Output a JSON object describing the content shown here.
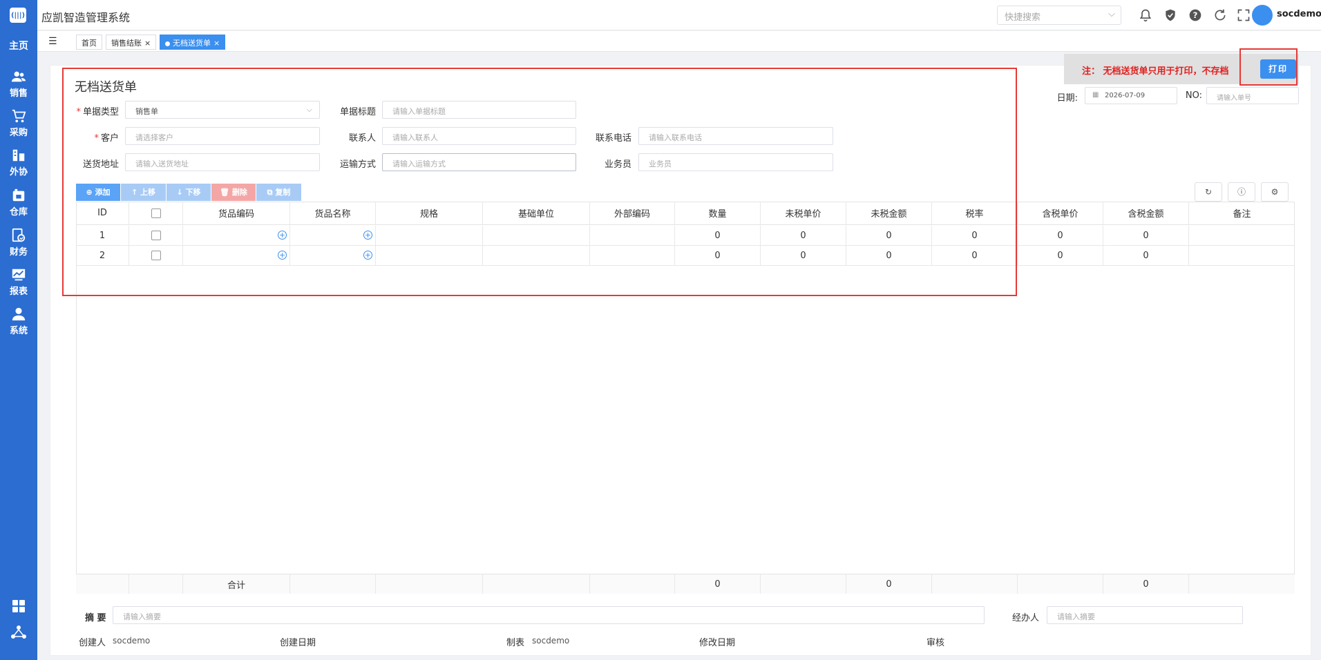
{
  "app": {
    "title": "应凯智造管理系统",
    "logo_text": "(|||)",
    "username": "socdemo"
  },
  "header": {
    "search_placeholder": "快捷搜索"
  },
  "sidebar": {
    "home": "主页",
    "items": [
      {
        "label": "销售",
        "icon": "users-icon"
      },
      {
        "label": "采购",
        "icon": "cart-icon"
      },
      {
        "label": "外协",
        "icon": "outsource-icon"
      },
      {
        "label": "仓库",
        "icon": "warehouse-icon"
      },
      {
        "label": "财务",
        "icon": "finance-icon"
      },
      {
        "label": "报表",
        "icon": "report-icon"
      },
      {
        "label": "系统",
        "icon": "user-icon"
      }
    ]
  },
  "tabs": [
    {
      "label": "首页",
      "closable": false,
      "active": false
    },
    {
      "label": "销售结账",
      "closable": true,
      "active": false
    },
    {
      "label": "无档送货单",
      "closable": true,
      "active": true
    }
  ],
  "tab_close_glyph": "×",
  "page": {
    "title": "无档送货单",
    "notice": "注：  无档送货单只用于打印，不存档",
    "print_label": "打印",
    "date_label": "日期:",
    "date_value": "2026-07-09",
    "no_label": "NO:",
    "no_placeholder": "请输入单号"
  },
  "form": {
    "doc_type_label": "单据类型",
    "doc_type_value": "销售单",
    "doc_title_label": "单据标题",
    "doc_title_placeholder": "请输入单据标题",
    "customer_label": "客户",
    "customer_placeholder": "请选择客户",
    "contact_label": "联系人",
    "contact_placeholder": "请输入联系人",
    "phone_label": "联系电话",
    "phone_placeholder": "请输入联系电话",
    "address_label": "送货地址",
    "address_placeholder": "请输入送货地址",
    "shipping_label": "运输方式",
    "shipping_placeholder": "请输入运输方式",
    "salesman_label": "业务员",
    "salesman_placeholder": "业务员"
  },
  "toolbar": {
    "add": "添加",
    "up": "上移",
    "down": "下移",
    "delete": "删除",
    "copy": "复制"
  },
  "table": {
    "columns": [
      "ID",
      "",
      "货品编码",
      "货品名称",
      "规格",
      "基础单位",
      "外部编码",
      "数量",
      "未税单价",
      "未税金额",
      "税率",
      "含税单价",
      "含税金额",
      "备注"
    ],
    "rows": [
      {
        "id": "1",
        "qty": "0",
        "price": "0",
        "amount": "0",
        "tax": "0",
        "tax_price": "0",
        "tax_amount": "0"
      },
      {
        "id": "2",
        "qty": "0",
        "price": "0",
        "amount": "0",
        "tax": "0",
        "tax_price": "0",
        "tax_amount": "0"
      }
    ],
    "footer": {
      "label": "合计",
      "qty": "0",
      "amount": "0",
      "tax_amount": "0"
    }
  },
  "bottom": {
    "summary_label": "摘 要",
    "summary_placeholder": "请输入摘要",
    "handler_label": "经办人",
    "handler_placeholder": "请输入摘要",
    "creator_label": "创建人",
    "creator_value": "socdemo",
    "create_date_label": "创建日期",
    "maker_label": "制表",
    "maker_value": "socdemo",
    "modify_date_label": "修改日期",
    "audit_label": "审核"
  },
  "colors": {
    "sidebar": "#2b6dd1",
    "accent": "#3b8fef",
    "highlight": "#e53935"
  }
}
